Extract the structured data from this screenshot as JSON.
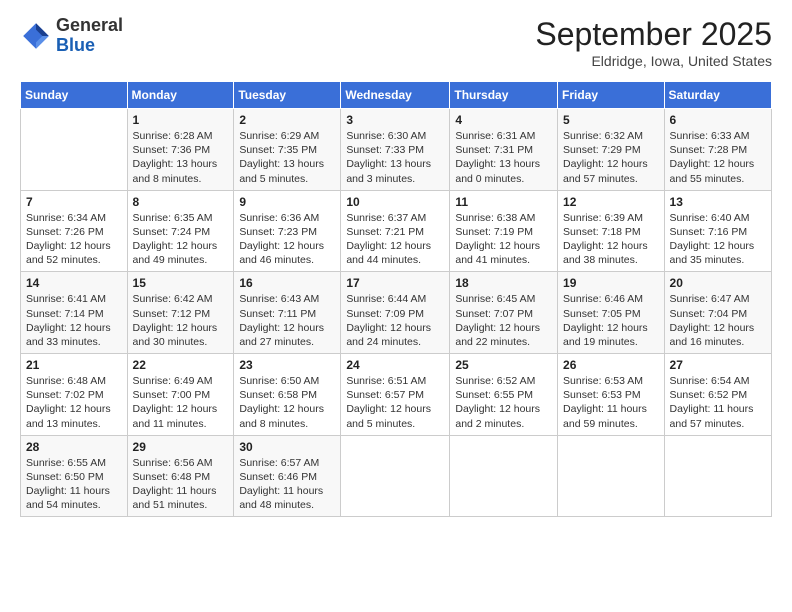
{
  "header": {
    "logo_general": "General",
    "logo_blue": "Blue",
    "month_title": "September 2025",
    "location": "Eldridge, Iowa, United States"
  },
  "weekdays": [
    "Sunday",
    "Monday",
    "Tuesday",
    "Wednesday",
    "Thursday",
    "Friday",
    "Saturday"
  ],
  "weeks": [
    [
      {
        "day": "",
        "info": ""
      },
      {
        "day": "1",
        "info": "Sunrise: 6:28 AM\nSunset: 7:36 PM\nDaylight: 13 hours\nand 8 minutes."
      },
      {
        "day": "2",
        "info": "Sunrise: 6:29 AM\nSunset: 7:35 PM\nDaylight: 13 hours\nand 5 minutes."
      },
      {
        "day": "3",
        "info": "Sunrise: 6:30 AM\nSunset: 7:33 PM\nDaylight: 13 hours\nand 3 minutes."
      },
      {
        "day": "4",
        "info": "Sunrise: 6:31 AM\nSunset: 7:31 PM\nDaylight: 13 hours\nand 0 minutes."
      },
      {
        "day": "5",
        "info": "Sunrise: 6:32 AM\nSunset: 7:29 PM\nDaylight: 12 hours\nand 57 minutes."
      },
      {
        "day": "6",
        "info": "Sunrise: 6:33 AM\nSunset: 7:28 PM\nDaylight: 12 hours\nand 55 minutes."
      }
    ],
    [
      {
        "day": "7",
        "info": "Sunrise: 6:34 AM\nSunset: 7:26 PM\nDaylight: 12 hours\nand 52 minutes."
      },
      {
        "day": "8",
        "info": "Sunrise: 6:35 AM\nSunset: 7:24 PM\nDaylight: 12 hours\nand 49 minutes."
      },
      {
        "day": "9",
        "info": "Sunrise: 6:36 AM\nSunset: 7:23 PM\nDaylight: 12 hours\nand 46 minutes."
      },
      {
        "day": "10",
        "info": "Sunrise: 6:37 AM\nSunset: 7:21 PM\nDaylight: 12 hours\nand 44 minutes."
      },
      {
        "day": "11",
        "info": "Sunrise: 6:38 AM\nSunset: 7:19 PM\nDaylight: 12 hours\nand 41 minutes."
      },
      {
        "day": "12",
        "info": "Sunrise: 6:39 AM\nSunset: 7:18 PM\nDaylight: 12 hours\nand 38 minutes."
      },
      {
        "day": "13",
        "info": "Sunrise: 6:40 AM\nSunset: 7:16 PM\nDaylight: 12 hours\nand 35 minutes."
      }
    ],
    [
      {
        "day": "14",
        "info": "Sunrise: 6:41 AM\nSunset: 7:14 PM\nDaylight: 12 hours\nand 33 minutes."
      },
      {
        "day": "15",
        "info": "Sunrise: 6:42 AM\nSunset: 7:12 PM\nDaylight: 12 hours\nand 30 minutes."
      },
      {
        "day": "16",
        "info": "Sunrise: 6:43 AM\nSunset: 7:11 PM\nDaylight: 12 hours\nand 27 minutes."
      },
      {
        "day": "17",
        "info": "Sunrise: 6:44 AM\nSunset: 7:09 PM\nDaylight: 12 hours\nand 24 minutes."
      },
      {
        "day": "18",
        "info": "Sunrise: 6:45 AM\nSunset: 7:07 PM\nDaylight: 12 hours\nand 22 minutes."
      },
      {
        "day": "19",
        "info": "Sunrise: 6:46 AM\nSunset: 7:05 PM\nDaylight: 12 hours\nand 19 minutes."
      },
      {
        "day": "20",
        "info": "Sunrise: 6:47 AM\nSunset: 7:04 PM\nDaylight: 12 hours\nand 16 minutes."
      }
    ],
    [
      {
        "day": "21",
        "info": "Sunrise: 6:48 AM\nSunset: 7:02 PM\nDaylight: 12 hours\nand 13 minutes."
      },
      {
        "day": "22",
        "info": "Sunrise: 6:49 AM\nSunset: 7:00 PM\nDaylight: 12 hours\nand 11 minutes."
      },
      {
        "day": "23",
        "info": "Sunrise: 6:50 AM\nSunset: 6:58 PM\nDaylight: 12 hours\nand 8 minutes."
      },
      {
        "day": "24",
        "info": "Sunrise: 6:51 AM\nSunset: 6:57 PM\nDaylight: 12 hours\nand 5 minutes."
      },
      {
        "day": "25",
        "info": "Sunrise: 6:52 AM\nSunset: 6:55 PM\nDaylight: 12 hours\nand 2 minutes."
      },
      {
        "day": "26",
        "info": "Sunrise: 6:53 AM\nSunset: 6:53 PM\nDaylight: 11 hours\nand 59 minutes."
      },
      {
        "day": "27",
        "info": "Sunrise: 6:54 AM\nSunset: 6:52 PM\nDaylight: 11 hours\nand 57 minutes."
      }
    ],
    [
      {
        "day": "28",
        "info": "Sunrise: 6:55 AM\nSunset: 6:50 PM\nDaylight: 11 hours\nand 54 minutes."
      },
      {
        "day": "29",
        "info": "Sunrise: 6:56 AM\nSunset: 6:48 PM\nDaylight: 11 hours\nand 51 minutes."
      },
      {
        "day": "30",
        "info": "Sunrise: 6:57 AM\nSunset: 6:46 PM\nDaylight: 11 hours\nand 48 minutes."
      },
      {
        "day": "",
        "info": ""
      },
      {
        "day": "",
        "info": ""
      },
      {
        "day": "",
        "info": ""
      },
      {
        "day": "",
        "info": ""
      }
    ]
  ]
}
